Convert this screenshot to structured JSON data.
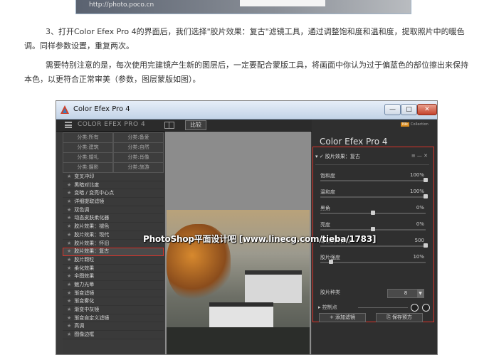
{
  "top_image": {
    "watermark_url": "http://photo.poco.cn"
  },
  "paragraphs": {
    "p1": "3、打开Color Efex Pro 4的界面后，我们选择\"胶片效果：复古\"滤镜工具，通过调整饱和度和温和度，提取照片中的暖色调。同样参数设置，重复两次。",
    "p2": "需要特别注意的是，每次使用完建镜产生新的图层后，一定要配合蒙版工具，将画面中你认为过于偏蓝色的部位擦出来保持本色，以更符合正常审美（参数，图层蒙版如图）。"
  },
  "app": {
    "title": "Color Efex Pro 4",
    "window_buttons": {
      "minimize": "—",
      "maximize": "□",
      "close": "✕"
    },
    "toolbar": {
      "brand": "COLOR EFEX PRO 4",
      "compare": "比较"
    },
    "categories": [
      "分类:所有",
      "分类:备爱",
      "分类:建筑",
      "分类:自然",
      "分类:婚礼",
      "分类:肖像",
      "分类:摄影",
      "分类:旅游"
    ],
    "filters": [
      "变叉冲印",
      "黑暗对比度",
      "变暗 / 变亮中心点",
      "详细提取滤镜",
      "双色调",
      "动态皮肤柔化器",
      "胶片效果：褪色",
      "胶片效果：现代",
      "胶片效果：怀旧",
      "胶片效果：复古",
      "胶片颗粒",
      "柔化效果",
      "伞图效果",
      "魅力光晕",
      "渐变滤镜",
      "渐变雾化",
      "渐变中灰镜",
      "渐变自定义滤镜",
      "高调",
      "图像边框"
    ],
    "selected_filter": "胶片效果：复古",
    "overlay_caption": "PhotoShop平面设计吧 [www.linecg.com/tieba/1783]",
    "right_panel": {
      "badge": "Nik",
      "badge_text": "Collection",
      "title": "Color Efex Pro 4",
      "filter_name": "胶片效果：复古",
      "header_controls": "≡ — ✕",
      "sliders": [
        {
          "label": "饱和度",
          "value": "100%",
          "level": 1.0
        },
        {
          "label": "温和度",
          "value": "100%",
          "level": 1.0
        },
        {
          "label": "黑角",
          "value": "0%",
          "level": 0.5
        },
        {
          "label": "亮度",
          "value": "0%",
          "level": 0.5
        },
        {
          "label": "每像素的微粒",
          "value": "500",
          "level": 1.0
        },
        {
          "label": "胶片强度",
          "value": "10%",
          "level": 0.1
        }
      ],
      "film_type_label": "胶片种类",
      "film_type_value": "8",
      "control_points_label": "控制点",
      "add_filter": "添加滤镜",
      "save_preset": "保存预方"
    }
  }
}
